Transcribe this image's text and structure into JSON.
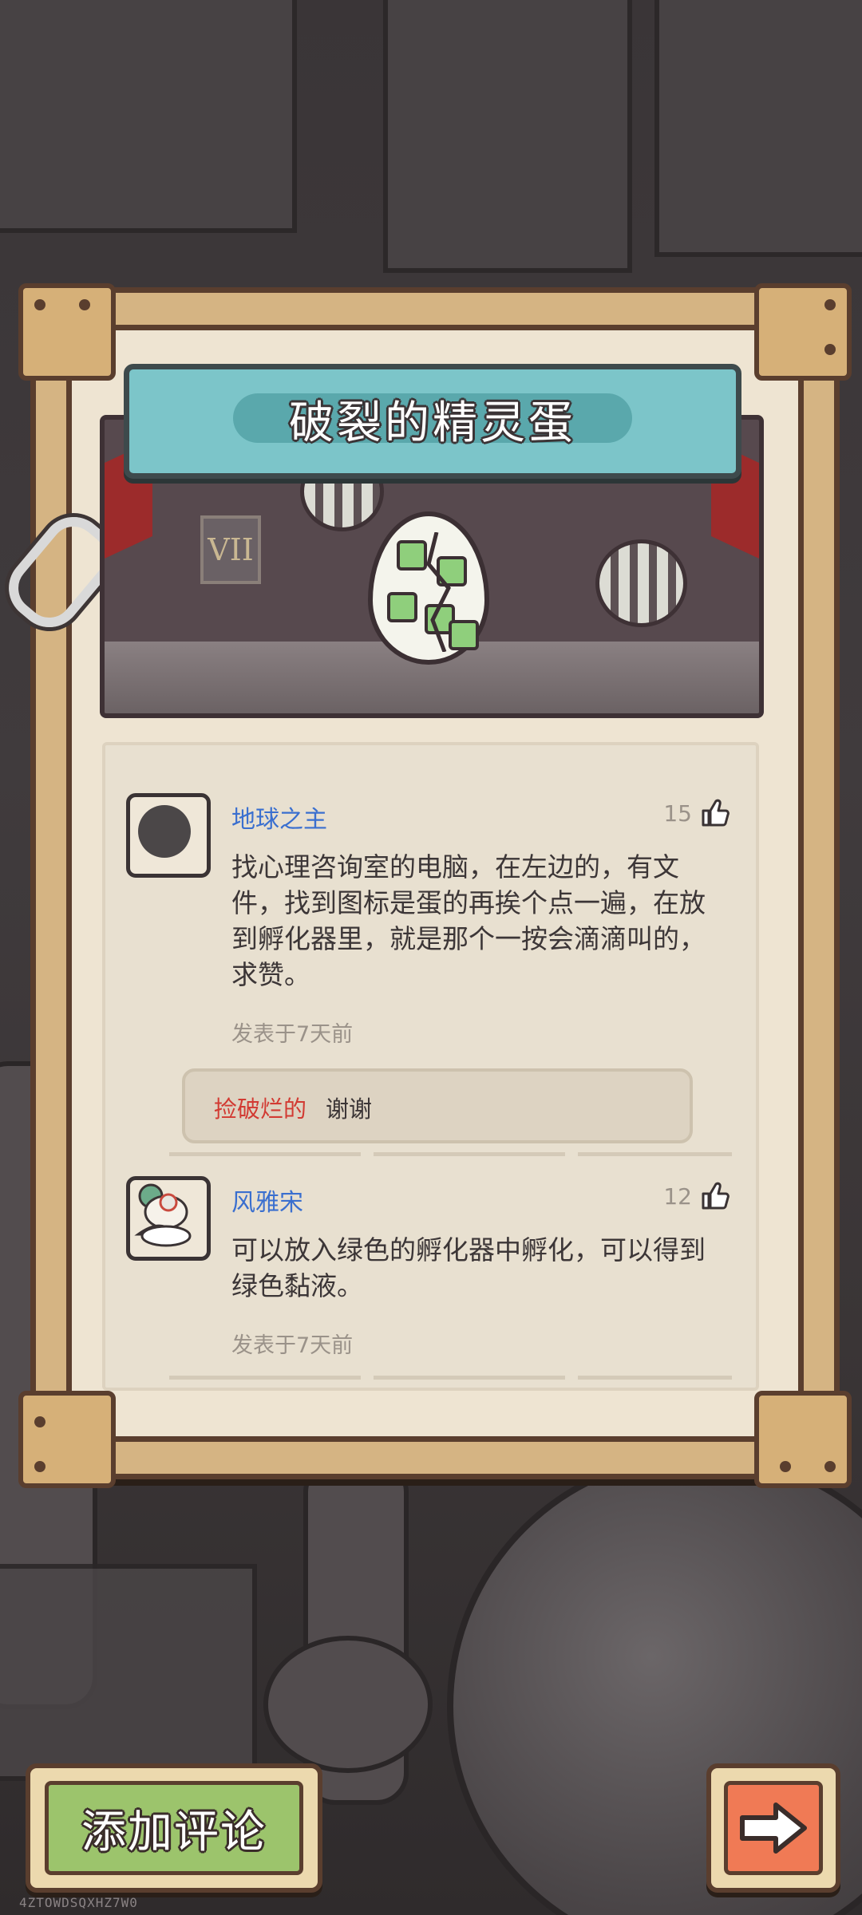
{
  "puzzle": {
    "title": "破裂的精灵蛋",
    "scene_plaque": "VII"
  },
  "comments": [
    {
      "user": "地球之主",
      "likes": "15",
      "text": "找心理咨询室的电脑，在左边的，有文件，找到图标是蛋的再挨个点一遍，在放到孵化器里，就是那个一按会滴滴叫的，求赞。",
      "posted": "发表于7天前",
      "reply": {
        "user": "捡破烂的",
        "text": "谢谢"
      }
    },
    {
      "user": "风雅宋",
      "likes": "12",
      "text": "可以放入绿色的孵化器中孵化，可以得到绿色黏液。",
      "posted": "发表于7天前"
    }
  ],
  "buttons": {
    "add_comment": "添加评论",
    "next_icon": "right-arrow-icon"
  },
  "watermark": "4ZTOWDSQXHZ7W0",
  "colors": {
    "username": "#3a6fcf",
    "reply_user": "#d23a32",
    "banner": "#7cc5c9",
    "add_button": "#9cc46c",
    "next_button": "#f07a55"
  }
}
